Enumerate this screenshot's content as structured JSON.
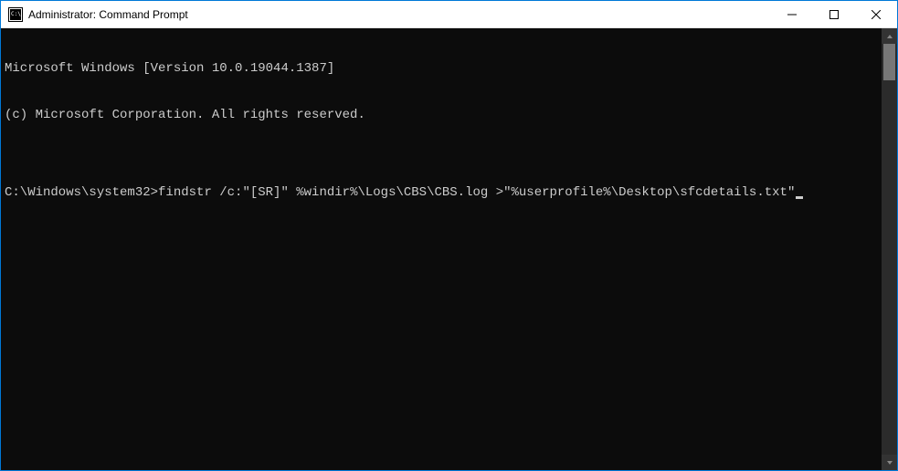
{
  "window": {
    "title": "Administrator: Command Prompt"
  },
  "terminal": {
    "lines": [
      "Microsoft Windows [Version 10.0.19044.1387]",
      "(c) Microsoft Corporation. All rights reserved.",
      "",
      ""
    ],
    "prompt": "C:\\Windows\\system32>",
    "command": "findstr /c:\"[SR]\" %windir%\\Logs\\CBS\\CBS.log >\"%userprofile%\\Desktop\\sfcdetails.txt\""
  }
}
